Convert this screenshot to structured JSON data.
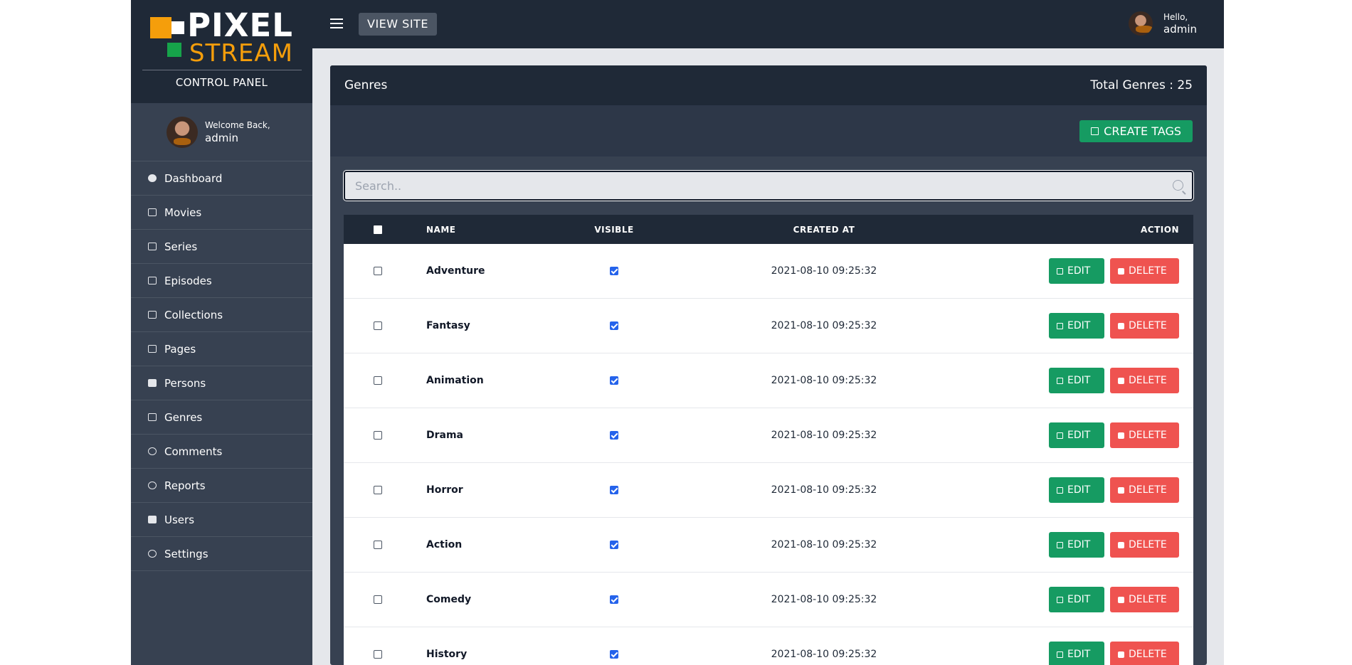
{
  "sidebar": {
    "logo_line1": "PIXEL",
    "logo_line2": "STREAM",
    "subtitle": "CONTROL PANEL",
    "welcome_line": "Welcome Back,",
    "username": "admin",
    "items": [
      {
        "label": "Dashboard",
        "icon": "dashboard-icon"
      },
      {
        "label": "Movies",
        "icon": "movie-icon"
      },
      {
        "label": "Series",
        "icon": "series-icon"
      },
      {
        "label": "Episodes",
        "icon": "episodes-icon"
      },
      {
        "label": "Collections",
        "icon": "collections-icon"
      },
      {
        "label": "Pages",
        "icon": "pages-icon"
      },
      {
        "label": "Persons",
        "icon": "persons-icon"
      },
      {
        "label": "Genres",
        "icon": "genres-icon"
      },
      {
        "label": "Comments",
        "icon": "comment-icon"
      },
      {
        "label": "Reports",
        "icon": "report-icon"
      },
      {
        "label": "Users",
        "icon": "users-icon"
      },
      {
        "label": "Settings",
        "icon": "gear-icon"
      }
    ]
  },
  "topbar": {
    "view_site": "VIEW SITE",
    "hello": "Hello,",
    "username": "admin"
  },
  "panel": {
    "title": "Genres",
    "total": "Total Genres : 25",
    "create_button": "CREATE TAGS"
  },
  "search": {
    "placeholder": "Search.."
  },
  "table": {
    "headers": {
      "name": "NAME",
      "visible": "VISIBLE",
      "created": "CREATED AT",
      "action": "ACTION"
    },
    "edit_label": "EDIT",
    "delete_label": "DELETE",
    "rows": [
      {
        "name": "Adventure",
        "visible": true,
        "created": "2021-08-10 09:25:32"
      },
      {
        "name": "Fantasy",
        "visible": true,
        "created": "2021-08-10 09:25:32"
      },
      {
        "name": "Animation",
        "visible": true,
        "created": "2021-08-10 09:25:32"
      },
      {
        "name": "Drama",
        "visible": true,
        "created": "2021-08-10 09:25:32"
      },
      {
        "name": "Horror",
        "visible": true,
        "created": "2021-08-10 09:25:32"
      },
      {
        "name": "Action",
        "visible": true,
        "created": "2021-08-10 09:25:32"
      },
      {
        "name": "Comedy",
        "visible": true,
        "created": "2021-08-10 09:25:32"
      },
      {
        "name": "History",
        "visible": true,
        "created": "2021-08-10 09:25:32"
      }
    ]
  },
  "colors": {
    "sidebar_bg": "#374151",
    "topbar_bg": "#1f2937",
    "edit_green": "#169b62",
    "delete_red": "#ef5350",
    "logo_orange": "#f59e0b",
    "logo_green": "#16a34a"
  }
}
